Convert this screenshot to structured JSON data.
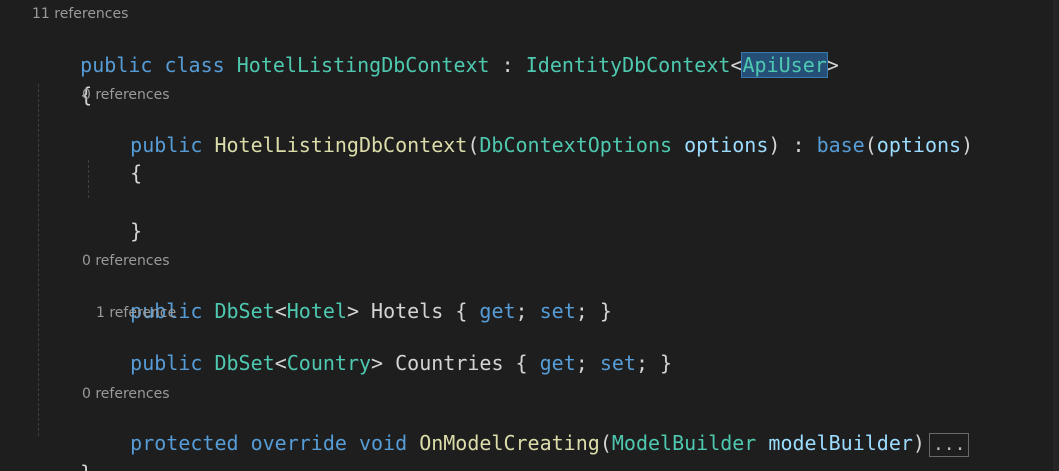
{
  "lenses": {
    "class_refs": "11 references",
    "ctor_refs": "0 references",
    "hotels_refs": "0 references",
    "countries_refs": "1 reference",
    "model_refs": "0 references"
  },
  "code": {
    "line1": {
      "public": "public",
      "class": "class",
      "name": "HotelListingDbContext",
      "colon": " : ",
      "base_type": "IdentityDbContext",
      "lt": "<",
      "generic": "ApiUser",
      "gt": ">"
    },
    "open_brace": "{",
    "close_brace": "}",
    "ctor": {
      "public": "public",
      "name": "HotelListingDbContext",
      "paren_open": "(",
      "param_type": "DbContextOptions",
      "param_name": "options",
      "paren_close": ")",
      "colon": " : ",
      "base": "base",
      "base_args_open": "(",
      "base_arg": "options",
      "base_args_close": ")",
      "open_brace": "{",
      "close_brace": "}"
    },
    "hotels": {
      "public": "public",
      "type": "DbSet",
      "lt": "<",
      "generic": "Hotel",
      "gt": ">",
      "name": "Hotels",
      "open": " { ",
      "get": "get",
      "semi1": "; ",
      "set": "set",
      "semi2": "; }"
    },
    "countries": {
      "public": "public",
      "type": "DbSet",
      "lt": "<",
      "generic": "Country",
      "gt": ">",
      "name": "Countries",
      "open": " { ",
      "get": "get",
      "semi1": "; ",
      "set": "set",
      "semi2": "; }"
    },
    "model": {
      "protected": "protected",
      "override": "override",
      "void": "void",
      "name": "OnModelCreating",
      "paren_open": "(",
      "param_type": "ModelBuilder",
      "param_name": "modelBuilder",
      "paren_close": ")",
      "collapsed": "..."
    }
  },
  "colors": {
    "keyword": "#569cd6",
    "type": "#4ec9b0",
    "method": "#dcdcaa",
    "parameter": "#9cdcfe",
    "background": "#1e1e1e"
  }
}
